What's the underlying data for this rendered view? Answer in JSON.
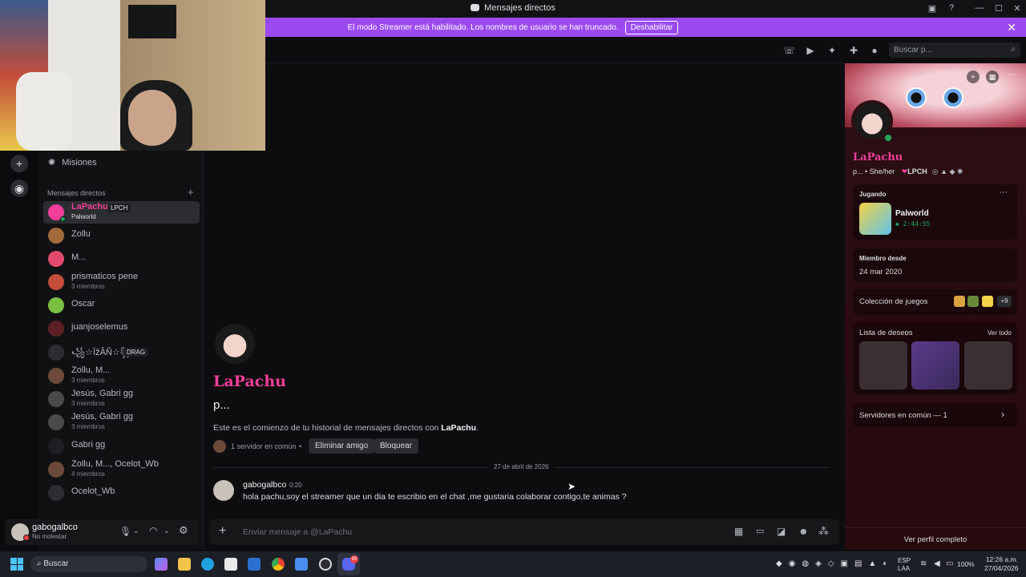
{
  "window": {
    "title": "Mensajes directos"
  },
  "banner": {
    "text": "El modo Streamer está habilitado. Los nombres de usuario se han truncado.",
    "button": "Deshabilitar"
  },
  "sidebar": {
    "missions": "Misiones",
    "dm_header": "Mensajes directos",
    "items": [
      {
        "name": "LaPachu",
        "tag": "LPCH",
        "sub": "Palworld",
        "color": "#f23f9a",
        "status": "online"
      },
      {
        "name": "Zollu",
        "sub": "",
        "color": "#a36a3c"
      },
      {
        "name": "M...",
        "sub": "",
        "color": "#e24a6c"
      },
      {
        "name": "prismaticos pene",
        "sub": "3 miembros",
        "color": "#c44d3a"
      },
      {
        "name": "Oscar",
        "sub": "",
        "color": "#7bc043"
      },
      {
        "name": "juanjoselemus",
        "sub": "",
        "color": "#5c1f24"
      },
      {
        "name": "꧁☆ÏžÂÑ☆꧂",
        "tag": "DRAG",
        "sub": "",
        "color": "#2b2d31"
      },
      {
        "name": "Zollu, M...",
        "sub": "3 miembros",
        "color": "#6b4a3a"
      },
      {
        "name": "Jesús, Gabri gg",
        "sub": "3 miembros",
        "color": "#4a4a4a"
      },
      {
        "name": "Jesús, Gabri gg",
        "sub": "3 miembros",
        "color": "#4a4a4a"
      },
      {
        "name": "Gabri gg",
        "sub": "",
        "color": "#1e1f22"
      },
      {
        "name": "Zollu, M..., Ocelot_Wb",
        "sub": "4 miembros",
        "color": "#6b4a3a"
      },
      {
        "name": "Ocelot_Wb",
        "sub": "",
        "color": "#2b2d31"
      }
    ]
  },
  "user": {
    "name": "gabogalbco",
    "status": "No molestar"
  },
  "chat": {
    "intro_name": "LaPachu",
    "intro_sub": "p...",
    "intro_text_prefix": "Este es el comienzo de tu historial de mensajes directos con ",
    "intro_text_name": "LaPachu",
    "intro_text_suffix": ".",
    "mutual": "1 servidor en común",
    "remove_friend": "Eliminar amigo",
    "block": "Bloquear",
    "date_divider": "27 de abril de 2026",
    "message": {
      "author": "gabogalbco",
      "time": "0:20",
      "text": "hola pachu,soy el streamer que un dia te escribio en el chat ,me gustaria colaborar contigo,te animas ?"
    },
    "composer_placeholder": "Enviar mensaje a @LaPachu"
  },
  "header": {
    "search_placeholder": "Buscar p..."
  },
  "profile": {
    "name": "LaPachu",
    "sub": "p...",
    "pronouns": "• She/her",
    "tag": "LPCH",
    "playing_label": "Jugando",
    "game": "Palworld",
    "game_time": "2:44:55",
    "member_since_label": "Miembro desde",
    "member_since": "24 mar 2020",
    "game_collection": "Colección de juegos",
    "game_collection_more": "+9",
    "wishlist": "Lista de deseos",
    "see_all": "Ver todo",
    "mutual_servers": "Servidores en común — 1",
    "full_profile": "Ver perfil completo"
  },
  "taskbar": {
    "search": "Buscar",
    "lang": "ESP",
    "lang2": "LAA",
    "battery": "100%",
    "time": "12:26 a.m.",
    "date": "27/04/2026",
    "badge": "99"
  }
}
